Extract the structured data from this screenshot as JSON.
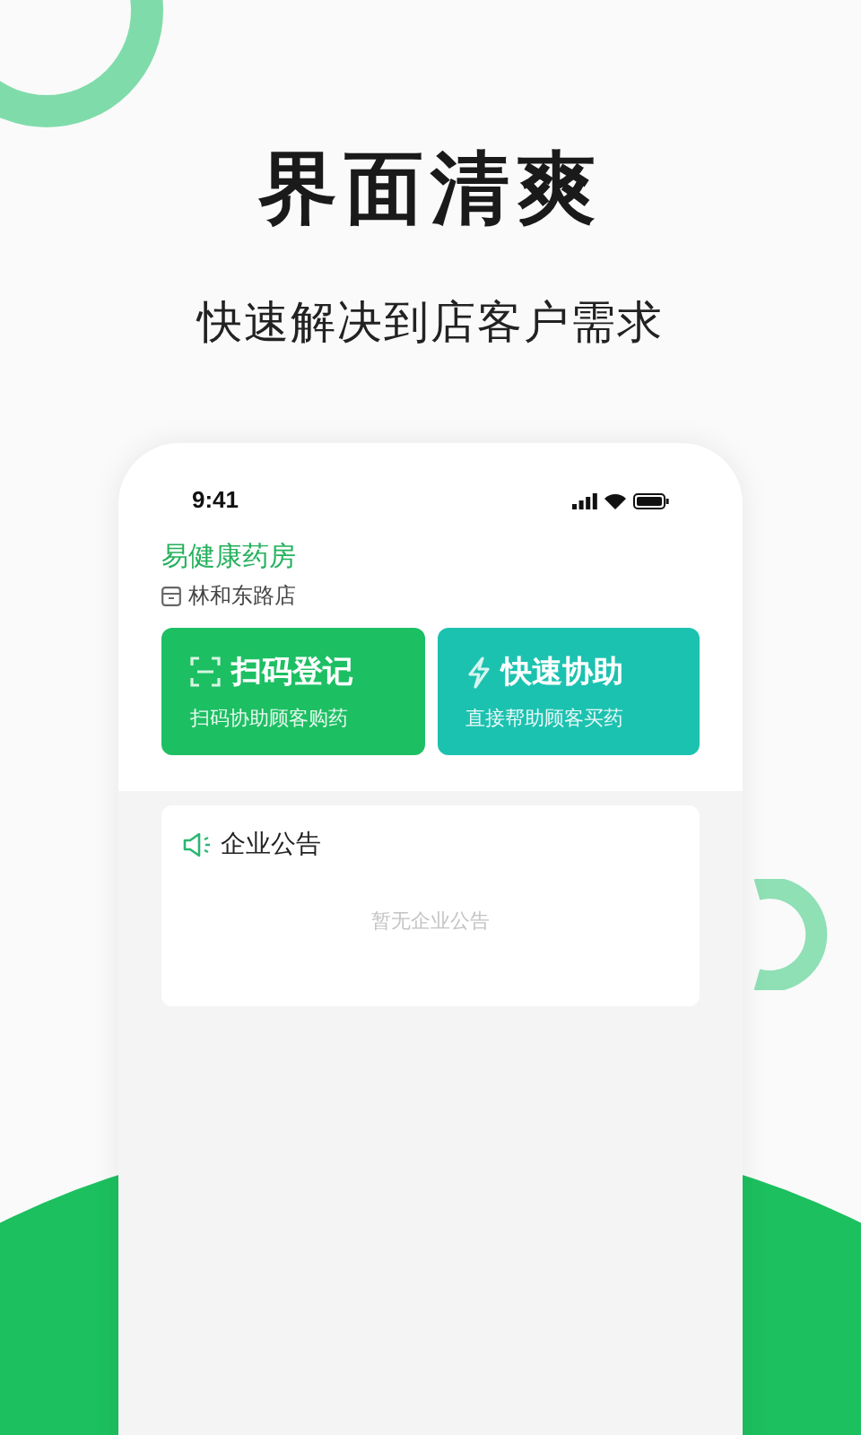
{
  "headline": "界面清爽",
  "subtitle": "快速解决到店客户需求",
  "phone": {
    "status_bar": {
      "time": "9:41"
    },
    "store": {
      "name": "易健康药房",
      "branch": "林和东路店"
    },
    "actions": [
      {
        "kind": "scan",
        "title": "扫码登记",
        "caption": "扫码协助顾客购药"
      },
      {
        "kind": "assist",
        "title": "快速协助",
        "caption": "直接帮助顾客买药"
      }
    ],
    "notice": {
      "title": "企业公告",
      "empty_text": "暂无企业公告"
    }
  }
}
